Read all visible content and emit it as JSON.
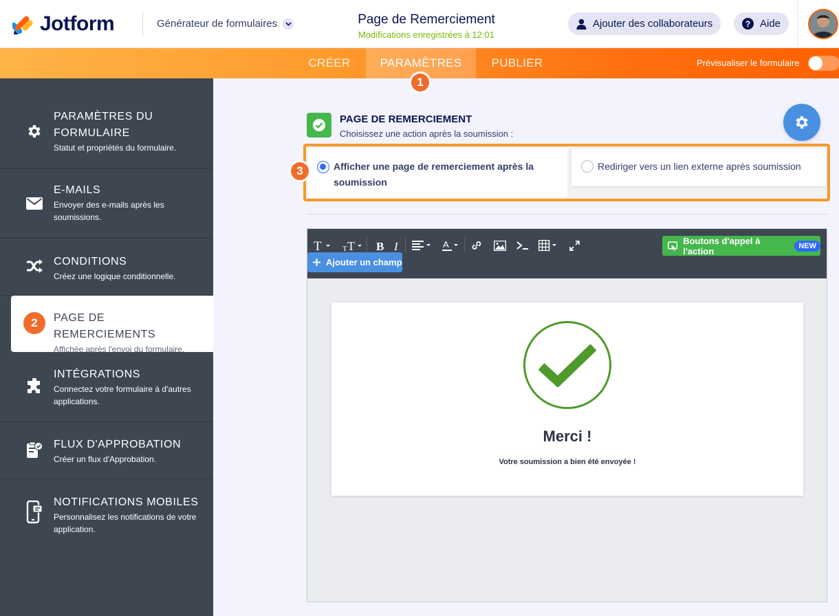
{
  "header": {
    "logo_text": "Jotform",
    "builder_label": "Générateur de formulaires",
    "page_title": "Page de Remerciement",
    "saved_status": "Modifications enregistrées à 12:01",
    "collab_button": "Ajouter des collaborateurs",
    "help_button": "Aide"
  },
  "nav": {
    "tabs": [
      "CRÉER",
      "PARAMÈTRES",
      "PUBLIER"
    ],
    "active_tab": "PARAMÈTRES",
    "preview_label": "Prévisualiser le formulaire",
    "preview_enabled": false
  },
  "badges": {
    "step1": "1",
    "step2": "2",
    "step3": "3"
  },
  "sidebar": {
    "items": [
      {
        "title": "PARAMÈTRES DU FORMULAIRE",
        "desc": "Statut et propriétés du formulaire.",
        "icon": "gear-icon"
      },
      {
        "title": "E-MAILS",
        "desc": "Envoyer des e-mails après les soumissions.",
        "icon": "envelope-icon"
      },
      {
        "title": "CONDITIONS",
        "desc": "Créez une logique conditionnelle.",
        "icon": "shuffle-icon"
      },
      {
        "title": "PAGE DE REMERCIEMENTS",
        "desc": "Affichée après l'envoi du formulaire.",
        "icon": "thankyou-icon",
        "active": true
      },
      {
        "title": "INTÉGRATIONS",
        "desc": "Connectez votre formulaire à d'autres applications.",
        "icon": "puzzle-icon"
      },
      {
        "title": "FLUX D'APPROBATION",
        "desc": "Créer un flux d'Approbation.",
        "icon": "approval-icon"
      },
      {
        "title": "NOTIFICATIONS MOBILES",
        "desc": "Personnalisez les notifications de votre application.",
        "icon": "mobile-icon"
      }
    ]
  },
  "main": {
    "section_title": "PAGE DE REMERCIEMENT",
    "section_subtitle": "Choisissez une action après la soumission :",
    "options": [
      {
        "label": "Afficher une page de remerciement après la soumission",
        "selected": true
      },
      {
        "label": "Rediriger vers un lien externe après soumission",
        "selected": false
      }
    ]
  },
  "editor": {
    "cta_button": "Boutons d'appel à l'action",
    "new_badge": "NEW",
    "add_field_button": "Ajouter un champ",
    "preview": {
      "heading": "Merci !",
      "message": "Votre soumission a bien été envoyée !"
    }
  },
  "colors": {
    "brand_orange": "#ff6100",
    "sidebar_bg": "#3e4652",
    "accent_blue": "#4a90e2",
    "success_green": "#45b74c",
    "highlight_border": "#f39a2c"
  }
}
